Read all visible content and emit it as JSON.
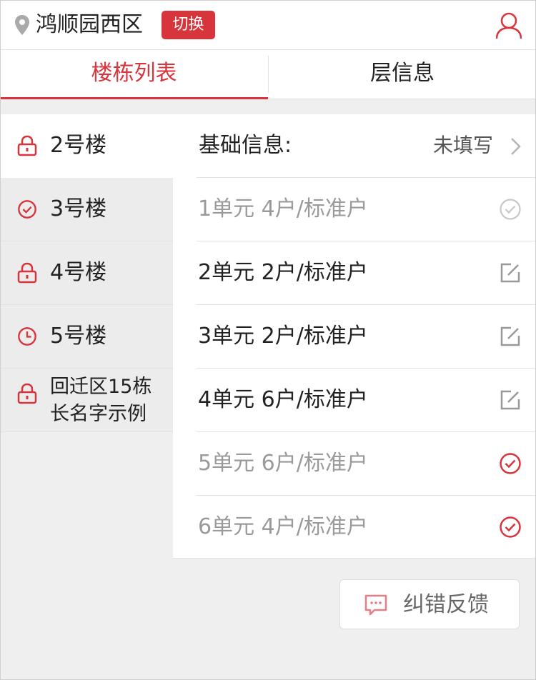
{
  "header": {
    "location_icon": "map-pin-icon",
    "community_name": "鸿顺园西区",
    "switch_label": "切换",
    "user_icon": "user-icon"
  },
  "tabs": [
    {
      "label": "楼栋列表",
      "active": true
    },
    {
      "label": "层信息",
      "active": false
    }
  ],
  "buildings": [
    {
      "label": "2号楼",
      "icon": "lock-icon",
      "status": "locked",
      "active": true
    },
    {
      "label": "3号楼",
      "icon": "check-circle-icon",
      "status": "done",
      "active": false
    },
    {
      "label": "4号楼",
      "icon": "lock-icon",
      "status": "locked",
      "active": false
    },
    {
      "label": "5号楼",
      "icon": "clock-icon",
      "status": "pending",
      "active": false
    },
    {
      "label": "回迁区15栋长名字示例",
      "icon": "lock-icon",
      "status": "locked",
      "active": false
    }
  ],
  "basic_info": {
    "label": "基础信息:",
    "value": "未填写"
  },
  "units": [
    {
      "text": "1单元  4户/标准户",
      "icon": "check-circle-gray-icon",
      "muted": true
    },
    {
      "text": "2单元  2户/标准户",
      "icon": "edit-icon",
      "muted": false
    },
    {
      "text": "3单元  2户/标准户",
      "icon": "edit-icon",
      "muted": false
    },
    {
      "text": "4单元  6户/标准户",
      "icon": "edit-icon",
      "muted": false
    },
    {
      "text": "5单元  6户/标准户",
      "icon": "check-circle-red-icon",
      "muted": true
    },
    {
      "text": "6单元  4户/标准户",
      "icon": "check-circle-red-icon",
      "muted": true
    }
  ],
  "feedback": {
    "label": "纠错反馈",
    "icon": "chat-icon"
  },
  "colors": {
    "accent": "#d8343b",
    "muted_text": "#9a9a9a",
    "background": "#efefef"
  }
}
